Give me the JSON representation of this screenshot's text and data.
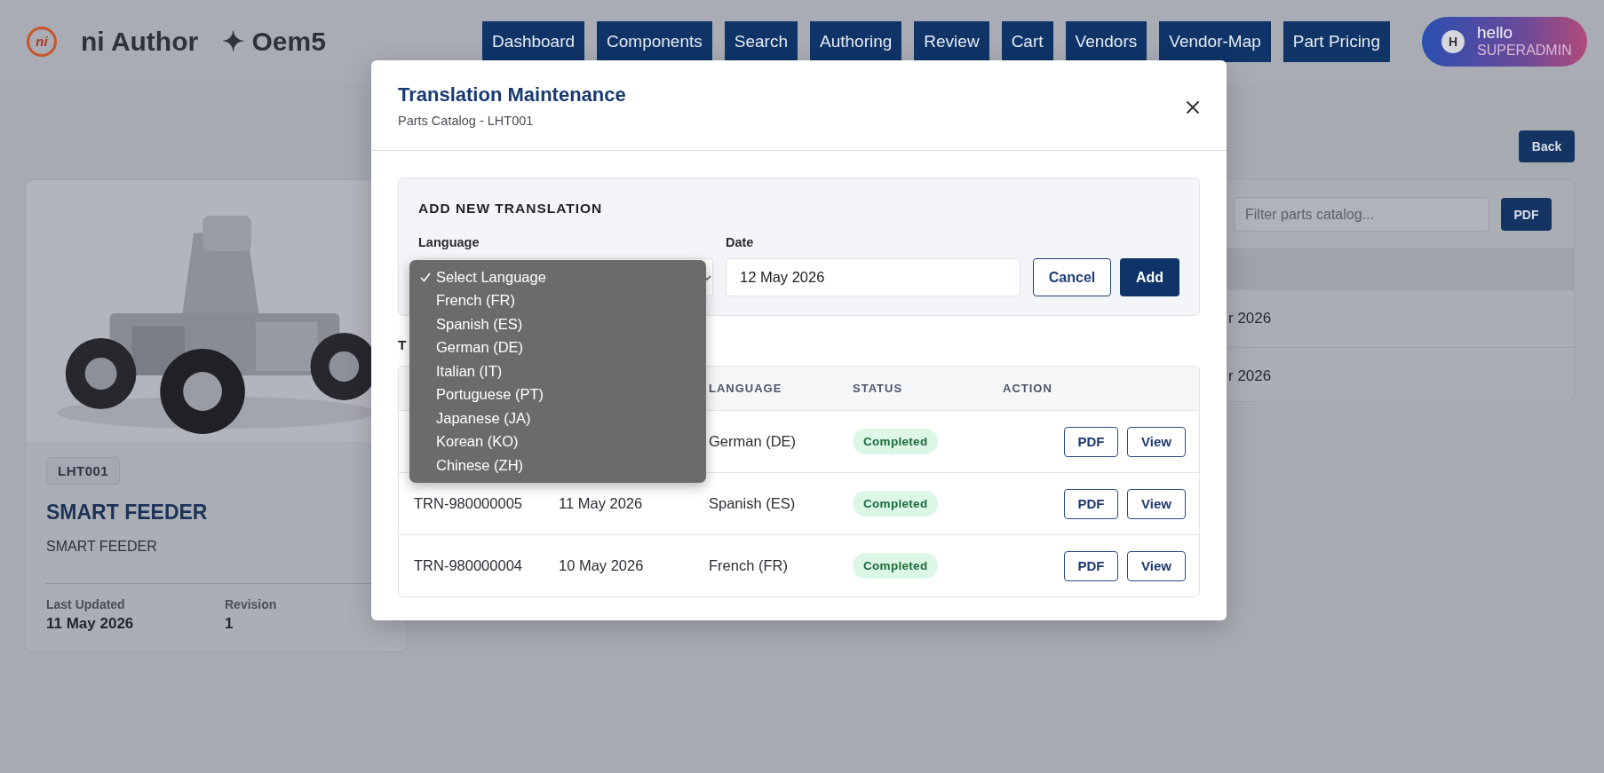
{
  "app": {
    "logo_text": "ni",
    "name": "ni Author",
    "tenant": "✦ Oem5"
  },
  "nav": [
    "Dashboard",
    "Components",
    "Search",
    "Authoring",
    "Review",
    "Cart",
    "Vendors",
    "Vendor-Map",
    "Part Pricing"
  ],
  "user": {
    "initial": "H",
    "greeting": "hello",
    "role": "SUPERADMIN"
  },
  "page": {
    "back_button": "Back",
    "filter": {
      "placeholder": "Filter parts catalog..."
    },
    "pdf_button": "PDF",
    "rows": [
      {
        "column_2": "r 2026"
      },
      {
        "column_2": "r 2026"
      }
    ]
  },
  "card": {
    "code": "LHT001",
    "title": "SMART FEEDER",
    "subtitle": "SMART FEEDER",
    "meta": [
      {
        "label": "Last Updated",
        "value": "11 May 2026"
      },
      {
        "label": "Revision",
        "value": "1"
      }
    ]
  },
  "modal": {
    "title": "Translation Maintenance",
    "subtitle": "Parts Catalog - LHT001",
    "add_section": {
      "heading": "ADD NEW TRANSLATION",
      "language_label": "Language",
      "date_label": "Date",
      "date_value": "12 May 2026",
      "buttons": [
        "Cancel",
        "Add"
      ]
    },
    "language_dropdown": {
      "expanded": true,
      "options": [
        {
          "label": "Select Language",
          "selected": true
        },
        {
          "label": "French (FR)",
          "selected": false
        },
        {
          "label": "Spanish (ES)",
          "selected": false
        },
        {
          "label": "German (DE)",
          "selected": false
        },
        {
          "label": "Italian (IT)",
          "selected": false
        },
        {
          "label": "Portuguese (PT)",
          "selected": false
        },
        {
          "label": "Japanese (JA)",
          "selected": false
        },
        {
          "label": "Korean (KO)",
          "selected": false
        },
        {
          "label": "Chinese (ZH)",
          "selected": false
        }
      ]
    },
    "list_heading": "T",
    "table": {
      "columns": [
        "LANGUAGE",
        "STATUS",
        "ACTION"
      ],
      "rows": [
        {
          "language": "German (DE)",
          "status": "Completed",
          "actions": [
            "PDF",
            "View"
          ]
        },
        {
          "id": "TRN-980000005",
          "date": "11 May 2026",
          "language": "Spanish (ES)",
          "status": "Completed",
          "actions": [
            "PDF",
            "View"
          ]
        },
        {
          "id": "TRN-980000004",
          "date": "10 May 2026",
          "language": "French (FR)",
          "status": "Completed",
          "actions": [
            "PDF",
            "View"
          ]
        }
      ]
    }
  }
}
